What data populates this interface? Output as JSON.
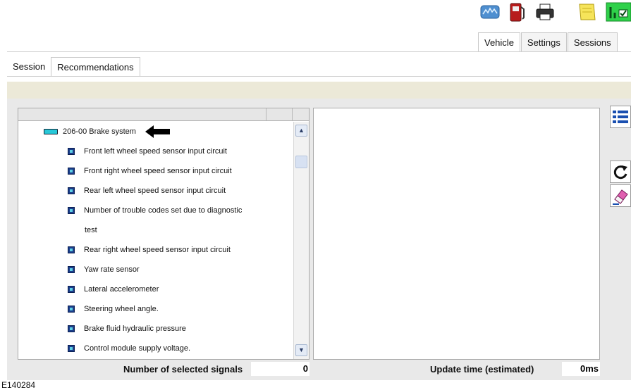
{
  "toolbar": {
    "icons": [
      "network-icon",
      "fuel-pump-icon",
      "printer-icon",
      "notes-icon",
      "checklist-icon"
    ]
  },
  "main_tabs": [
    {
      "label": "Vehicle",
      "active": true
    },
    {
      "label": "Settings",
      "active": false
    },
    {
      "label": "Sessions",
      "active": false
    }
  ],
  "sub_tabs": [
    {
      "label": "Session",
      "active": false
    },
    {
      "label": "Recommendations",
      "active": true
    }
  ],
  "tree": {
    "root_label": "206-00 Brake system",
    "items": [
      "Front left wheel speed sensor input circuit",
      "Front right wheel speed sensor input circuit",
      "Rear left wheel speed sensor input circuit",
      "Number of trouble codes set due to diagnostic",
      "test",
      "Rear right wheel speed sensor input circuit",
      "Yaw rate sensor",
      "Lateral accelerometer",
      "Steering wheel angle.",
      "Brake fluid hydraulic pressure",
      "Control module supply voltage."
    ]
  },
  "status": {
    "selected_signals_label": "Number of selected signals",
    "selected_signals_value": "0",
    "update_time_label": "Update time (estimated)",
    "update_time_value": "0ms"
  },
  "figure_id": "E140284",
  "colors": {
    "band": "#ece9d8",
    "root_icon": "#28c8d8",
    "item_icon": "#1b3d8a"
  }
}
